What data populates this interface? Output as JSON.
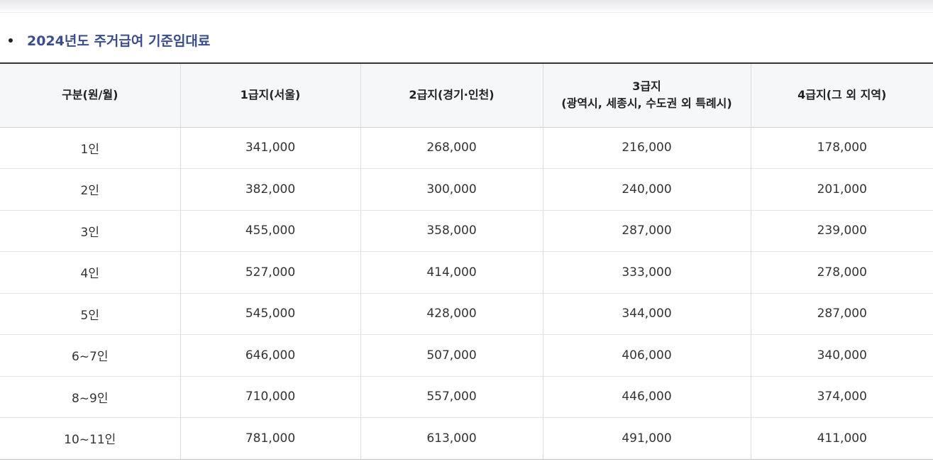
{
  "heading": "2024년도 주거급여 기준임대료",
  "table": {
    "headers": [
      {
        "line1": "구분(원/월)",
        "line2": ""
      },
      {
        "line1": "1급지(서울)",
        "line2": ""
      },
      {
        "line1": "2급지(경기·인천)",
        "line2": ""
      },
      {
        "line1": "3급지",
        "line2": "(광역시, 세종시, 수도권 외 특례시)"
      },
      {
        "line1": "4급지(그 외 지역)",
        "line2": ""
      }
    ],
    "rows": [
      [
        "1인",
        "341,000",
        "268,000",
        "216,000",
        "178,000"
      ],
      [
        "2인",
        "382,000",
        "300,000",
        "240,000",
        "201,000"
      ],
      [
        "3인",
        "455,000",
        "358,000",
        "287,000",
        "239,000"
      ],
      [
        "4인",
        "527,000",
        "414,000",
        "333,000",
        "278,000"
      ],
      [
        "5인",
        "545,000",
        "428,000",
        "344,000",
        "287,000"
      ],
      [
        "6~7인",
        "646,000",
        "507,000",
        "406,000",
        "340,000"
      ],
      [
        "8~9인",
        "710,000",
        "557,000",
        "446,000",
        "374,000"
      ],
      [
        "10~11인",
        "781,000",
        "613,000",
        "491,000",
        "411,000"
      ]
    ]
  }
}
